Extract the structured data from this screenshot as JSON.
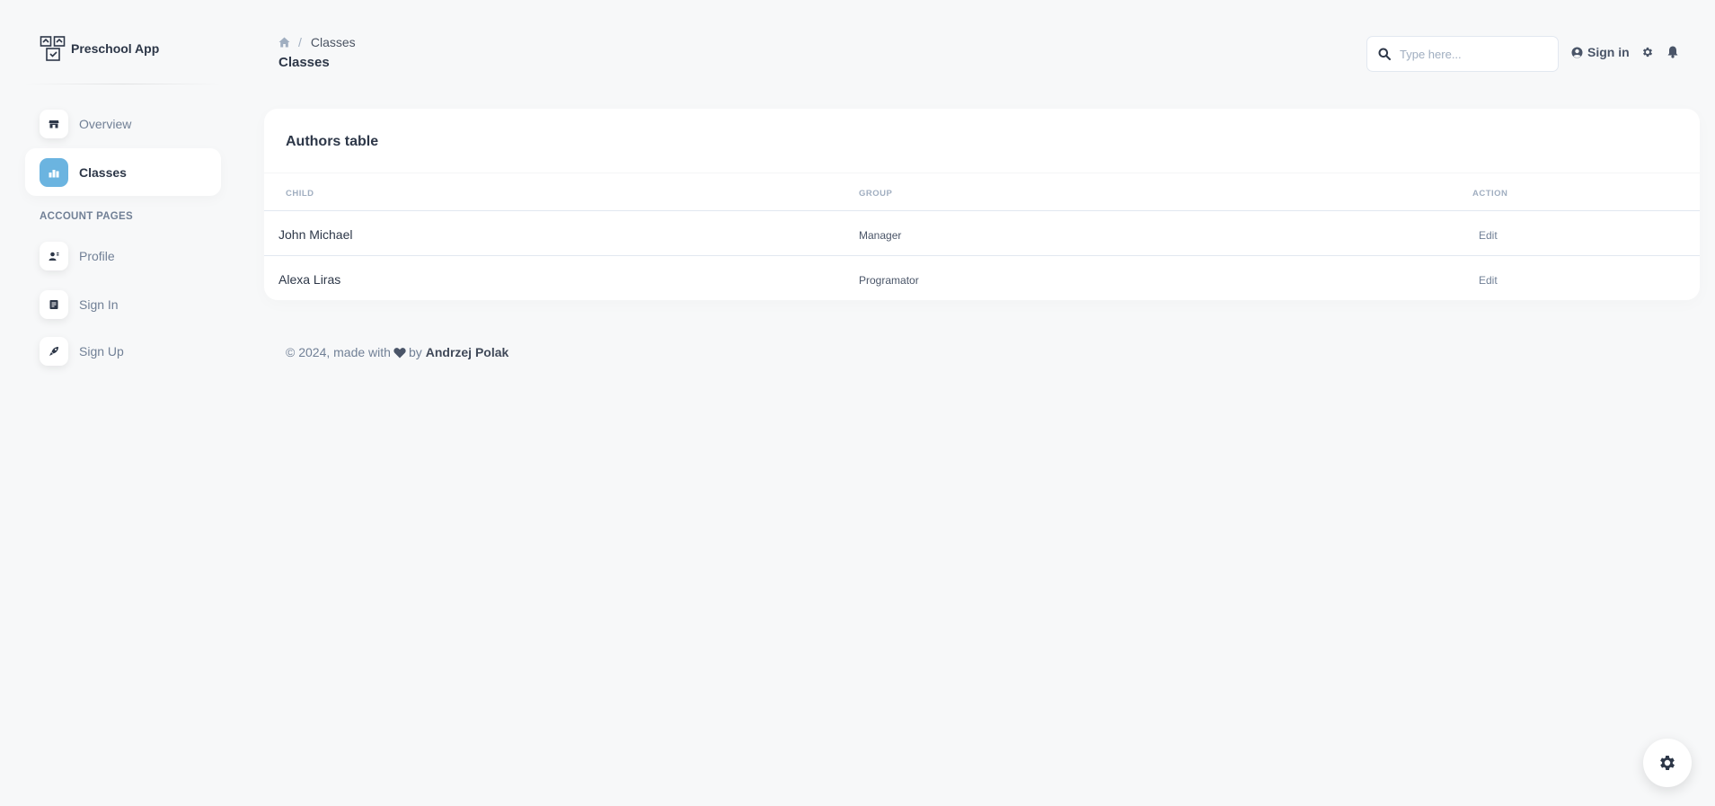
{
  "brand": {
    "name": "Preschool App"
  },
  "sidebar": {
    "items": [
      {
        "label": "Overview",
        "icon": "store-icon"
      },
      {
        "label": "Classes",
        "icon": "chart-bar-icon",
        "active": true
      }
    ],
    "account_section_title": "ACCOUNT PAGES",
    "account_items": [
      {
        "label": "Profile",
        "icon": "person-icon"
      },
      {
        "label": "Sign In",
        "icon": "document-icon"
      },
      {
        "label": "Sign Up",
        "icon": "rocket-icon"
      }
    ]
  },
  "header": {
    "breadcrumb": [
      "Classes"
    ],
    "title": "Classes",
    "search": {
      "placeholder": "Type here...",
      "value": ""
    },
    "signin_label": "Sign in"
  },
  "table": {
    "title": "Authors table",
    "columns": [
      "CHILD",
      "GROUP",
      "ACTION"
    ],
    "rows": [
      {
        "child": "John Michael",
        "group": "Manager",
        "action": "Edit"
      },
      {
        "child": "Alexa Liras",
        "group": "Programator",
        "action": "Edit"
      }
    ]
  },
  "footer": {
    "prefix": "© 2024, made with",
    "by": "by",
    "author": "Andrzej Polak"
  },
  "colors": {
    "accent": "#6bb4e0",
    "background": "#f7f8f9",
    "text_primary": "#2d3748",
    "text_muted": "#718096"
  }
}
